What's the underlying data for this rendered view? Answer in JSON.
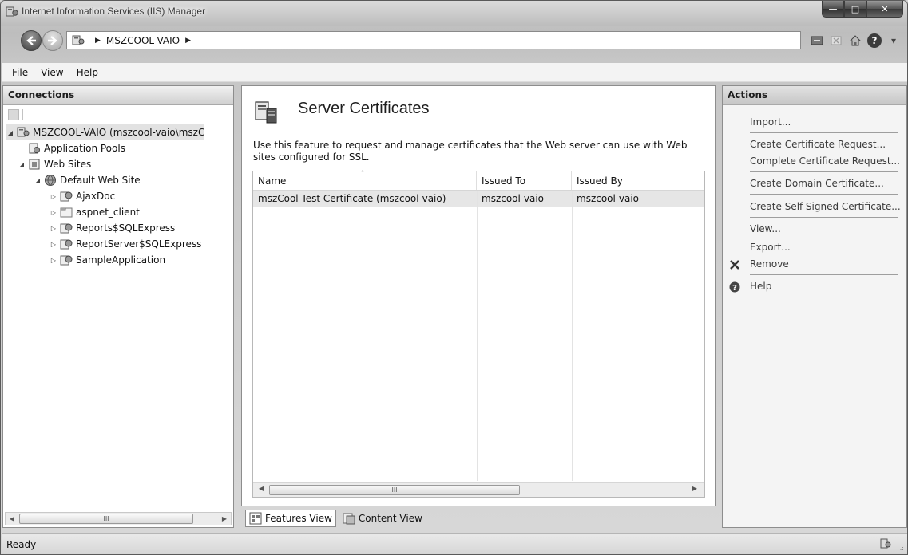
{
  "window": {
    "title": "Internet Information Services (IIS) Manager",
    "minimize": "—",
    "maximize": "□",
    "close": "✕"
  },
  "address": {
    "crumbs": [
      "MSZCOOL-VAIO"
    ],
    "separator": "▶"
  },
  "nav": {
    "back_icon": "back-arrow-icon",
    "forward_icon": "forward-arrow-icon"
  },
  "menu": [
    "File",
    "View",
    "Help"
  ],
  "connections": {
    "header": "Connections",
    "tree": [
      {
        "label": "MSZCOOL-VAIO (mszcool-vaio\\mszC",
        "icon": "server-icon",
        "toggle": "◢",
        "selected": true
      },
      {
        "label": "Application Pools",
        "icon": "app-pools-icon",
        "toggle": ""
      },
      {
        "label": "Web Sites",
        "icon": "web-sites-icon",
        "toggle": "◢"
      },
      {
        "label": "Default Web Site",
        "icon": "globe-icon",
        "toggle": "◢"
      },
      {
        "label": "AjaxDoc",
        "icon": "web-app-icon",
        "toggle": "▷"
      },
      {
        "label": "aspnet_client",
        "icon": "folder-icon",
        "toggle": "▷"
      },
      {
        "label": "Reports$SQLExpress",
        "icon": "web-app-icon",
        "toggle": "▷"
      },
      {
        "label": "ReportServer$SQLExpress",
        "icon": "web-app-icon",
        "toggle": "▷"
      },
      {
        "label": "SampleApplication",
        "icon": "web-app-icon",
        "toggle": "▷"
      }
    ],
    "scroll_grip": "III"
  },
  "feature": {
    "title": "Server Certificates",
    "description": "Use this feature to request and manage certificates that the Web server can use with Web sites configured for SSL.",
    "columns": [
      "Name",
      "Issued To",
      "Issued By"
    ],
    "sort_indicator": "˄",
    "rows": [
      {
        "name": "mszCool Test Certificate (mszcool-vaio)",
        "issued_to": "mszcool-vaio",
        "issued_by": "mszcool-vaio"
      }
    ],
    "scroll_grip": "III"
  },
  "view_tabs": {
    "features_view": "Features View",
    "content_view": "Content View"
  },
  "actions": {
    "header": "Actions",
    "items": [
      "Import...",
      "Create Certificate Request...",
      "Complete Certificate Request...",
      "Create Domain Certificate...",
      "Create Self-Signed Certificate...",
      "View...",
      "Export...",
      "Remove",
      "Help"
    ]
  },
  "status": {
    "text": "Ready",
    "grip": ".:"
  }
}
